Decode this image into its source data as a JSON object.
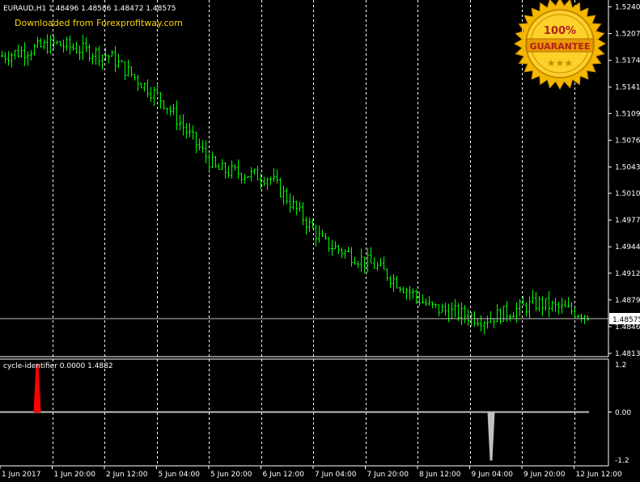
{
  "main_title": "EURAUD,H1  1.48496 1.48586 1.48472 1.48575",
  "watermark": "Downloaded from Forexprofitway.com",
  "badge": {
    "top": "100%",
    "middle": "GUARANTEE",
    "stars": "★★★"
  },
  "price_labels": [
    "1.52405",
    "1.52075",
    "1.51745",
    "1.51415",
    "1.51090",
    "1.50760",
    "1.50430",
    "1.50105",
    "1.49775",
    "1.49445",
    "1.49120",
    "1.48790",
    "1.48460",
    "1.48130"
  ],
  "current_price": "1.48575",
  "indicator_title": "cycle-identifier 0.0000 1.4882",
  "indicator_labels": [
    "1.2",
    "0.00",
    "-1.2"
  ],
  "time_labels": [
    "1 Jun 2017",
    "1 Jun 20:00",
    "2 Jun 12:00",
    "5 Jun 04:00",
    "5 Jun 20:00",
    "6 Jun 12:00",
    "7 Jun 04:00",
    "7 Jun 20:00",
    "8 Jun 12:00",
    "9 Jun 04:00",
    "9 Jun 20:00",
    "12 Jun 12:00"
  ],
  "colors": {
    "background": "#000000",
    "bars": "#00ff00",
    "grid": "#ffffff",
    "indicator_line": "#c0c0c0",
    "peak": "#ff0000",
    "trough": "#c0c0c0",
    "watermark": "#ffd700"
  },
  "chart_data": [
    {
      "type": "line",
      "title": "EURAUD,H1",
      "ylim": [
        1.4813,
        1.5244
      ],
      "x": [
        "1 Jun 2017",
        "1 Jun 20:00",
        "2 Jun 12:00",
        "5 Jun 04:00",
        "5 Jun 20:00",
        "6 Jun 12:00",
        "7 Jun 04:00",
        "7 Jun 20:00",
        "8 Jun 12:00",
        "9 Jun 04:00",
        "9 Jun 20:00",
        "12 Jun 12:00"
      ],
      "series": [
        {
          "values": [
            1.518,
            1.5195,
            1.518,
            1.5125,
            1.504,
            1.503,
            1.495,
            1.492,
            1.487,
            1.4855,
            1.4875,
            1.486
          ]
        }
      ],
      "current": 1.48575,
      "vertical_grid": true
    },
    {
      "type": "line",
      "title": "cycle-identifier",
      "ylim": [
        -1.2,
        1.2
      ],
      "baseline": 0.0,
      "events": [
        {
          "near": "1 Jun 20:00",
          "value": 1.2,
          "kind": "peak"
        },
        {
          "near": "9 Jun 04:00",
          "value": -1.2,
          "kind": "trough"
        }
      ]
    }
  ]
}
